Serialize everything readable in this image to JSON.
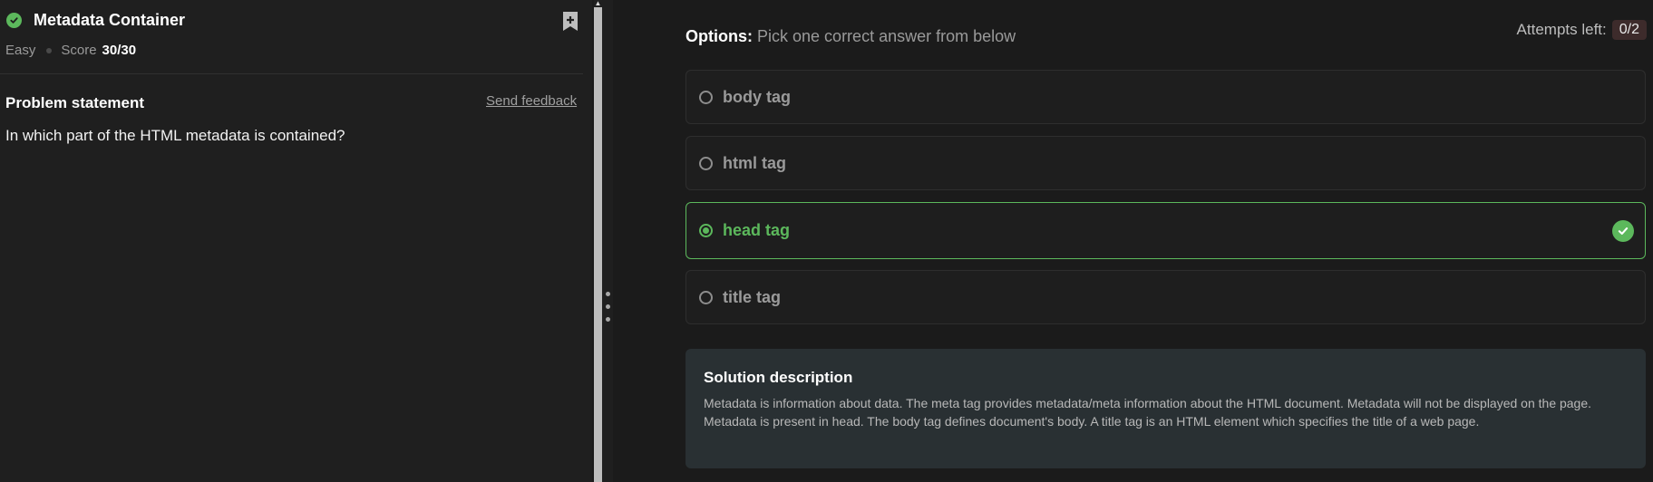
{
  "problem": {
    "title": "Metadata Container",
    "difficulty": "Easy",
    "score_label": "Score",
    "score_value": "30/30",
    "statement_label": "Problem statement",
    "feedback_label": "Send feedback",
    "question": "In which part of the HTML metadata is contained?"
  },
  "options_header": {
    "label": "Options:",
    "instruction": "Pick one correct answer from below"
  },
  "attempts": {
    "label": "Attempts left:",
    "value": "0/2"
  },
  "options": [
    {
      "label": "body tag"
    },
    {
      "label": "html tag"
    },
    {
      "label": "head tag"
    },
    {
      "label": "title tag"
    }
  ],
  "solution": {
    "title": "Solution description",
    "text": "Metadata is information about data. The meta tag provides metadata/meta information about the HTML document. Metadata will not be displayed on the page. Metadata is present in head. The body tag defines document's body. A title tag is an HTML element which specifies the title of a web page."
  },
  "colors": {
    "success": "#5cb85c",
    "background": "#1b1b1b",
    "solution_bg": "#293033"
  },
  "icons": [
    "check-circle-icon",
    "bookmark-add-icon",
    "radio-icon",
    "drag-handle-icon"
  ]
}
